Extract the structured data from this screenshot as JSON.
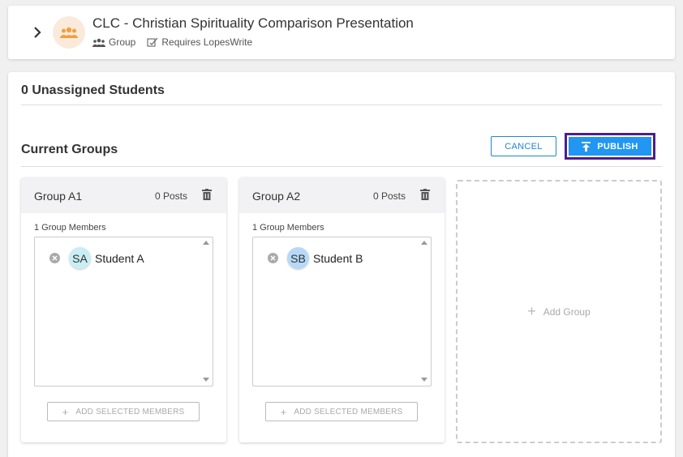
{
  "header": {
    "title": "CLC - Christian Spirituality Comparison Presentation",
    "type_label": "Group",
    "requirement_label": "Requires LopesWrite",
    "avatar_color": "#faeadb",
    "avatar_icon_color": "#f0a040"
  },
  "main": {
    "unassigned_label": "0 Unassigned Students",
    "current_groups_label": "Current Groups",
    "cancel_label": "CANCEL",
    "publish_label": "PUBLISH",
    "accent_color": "#2196f3",
    "publish_outline_color": "#4b1d96"
  },
  "groups": [
    {
      "name": "Group A1",
      "posts": "0 Posts",
      "members_label": "1 Group Members",
      "members": [
        {
          "initials": "SA",
          "name": "Student A",
          "color": "#c9eef4"
        }
      ],
      "add_label": "ADD SELECTED MEMBERS"
    },
    {
      "name": "Group A2",
      "posts": "0 Posts",
      "members_label": "1 Group Members",
      "members": [
        {
          "initials": "SB",
          "name": "Student B",
          "color": "#b7d9f7"
        }
      ],
      "add_label": "ADD SELECTED MEMBERS"
    }
  ],
  "add_group_label": "Add Group",
  "icons": {
    "expand": "chevron-right-icon",
    "group": "group-icon",
    "lopeswrite": "lopeswrite-icon",
    "publish": "upload-icon",
    "delete": "trash-icon",
    "remove": "remove-circle-icon",
    "add": "plus-icon"
  }
}
